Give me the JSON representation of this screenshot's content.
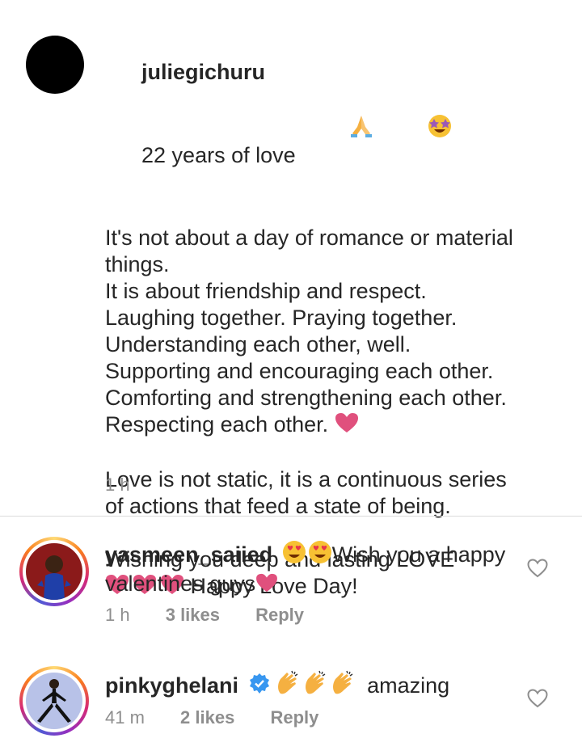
{
  "caption": {
    "username": "juliegichuru",
    "first_line_text": "22 years of love",
    "lines": [
      "It's not about a day of romance or material",
      "things.",
      "It is about friendship and respect.",
      "Laughing together. Praying together.",
      "Understanding each other, well.",
      "Supporting and encouraging each other.",
      "Comforting and strengthening each other.",
      "Respecting each other."
    ],
    "para2": [
      "Love is not static, it is a continuous series",
      "of actions that feed a state of being."
    ],
    "para3_line1": "Wishing you deep and lasting LOVE",
    "para3_line2": "Happy Love Day!",
    "time": "1 h"
  },
  "comments": [
    {
      "username": "yasmeen_saiied",
      "text_line1": "Wish you a happy",
      "text_line2": "valentines guys",
      "time": "1 h",
      "likes": "3 likes",
      "reply": "Reply"
    },
    {
      "username": "pinkyghelani",
      "text": "amazing",
      "time": "41 m",
      "likes": "2 likes",
      "reply": "Reply"
    }
  ],
  "colors": {
    "heart": "#e0507d",
    "verified": "#3897f0",
    "meta": "#8e8e8e"
  }
}
